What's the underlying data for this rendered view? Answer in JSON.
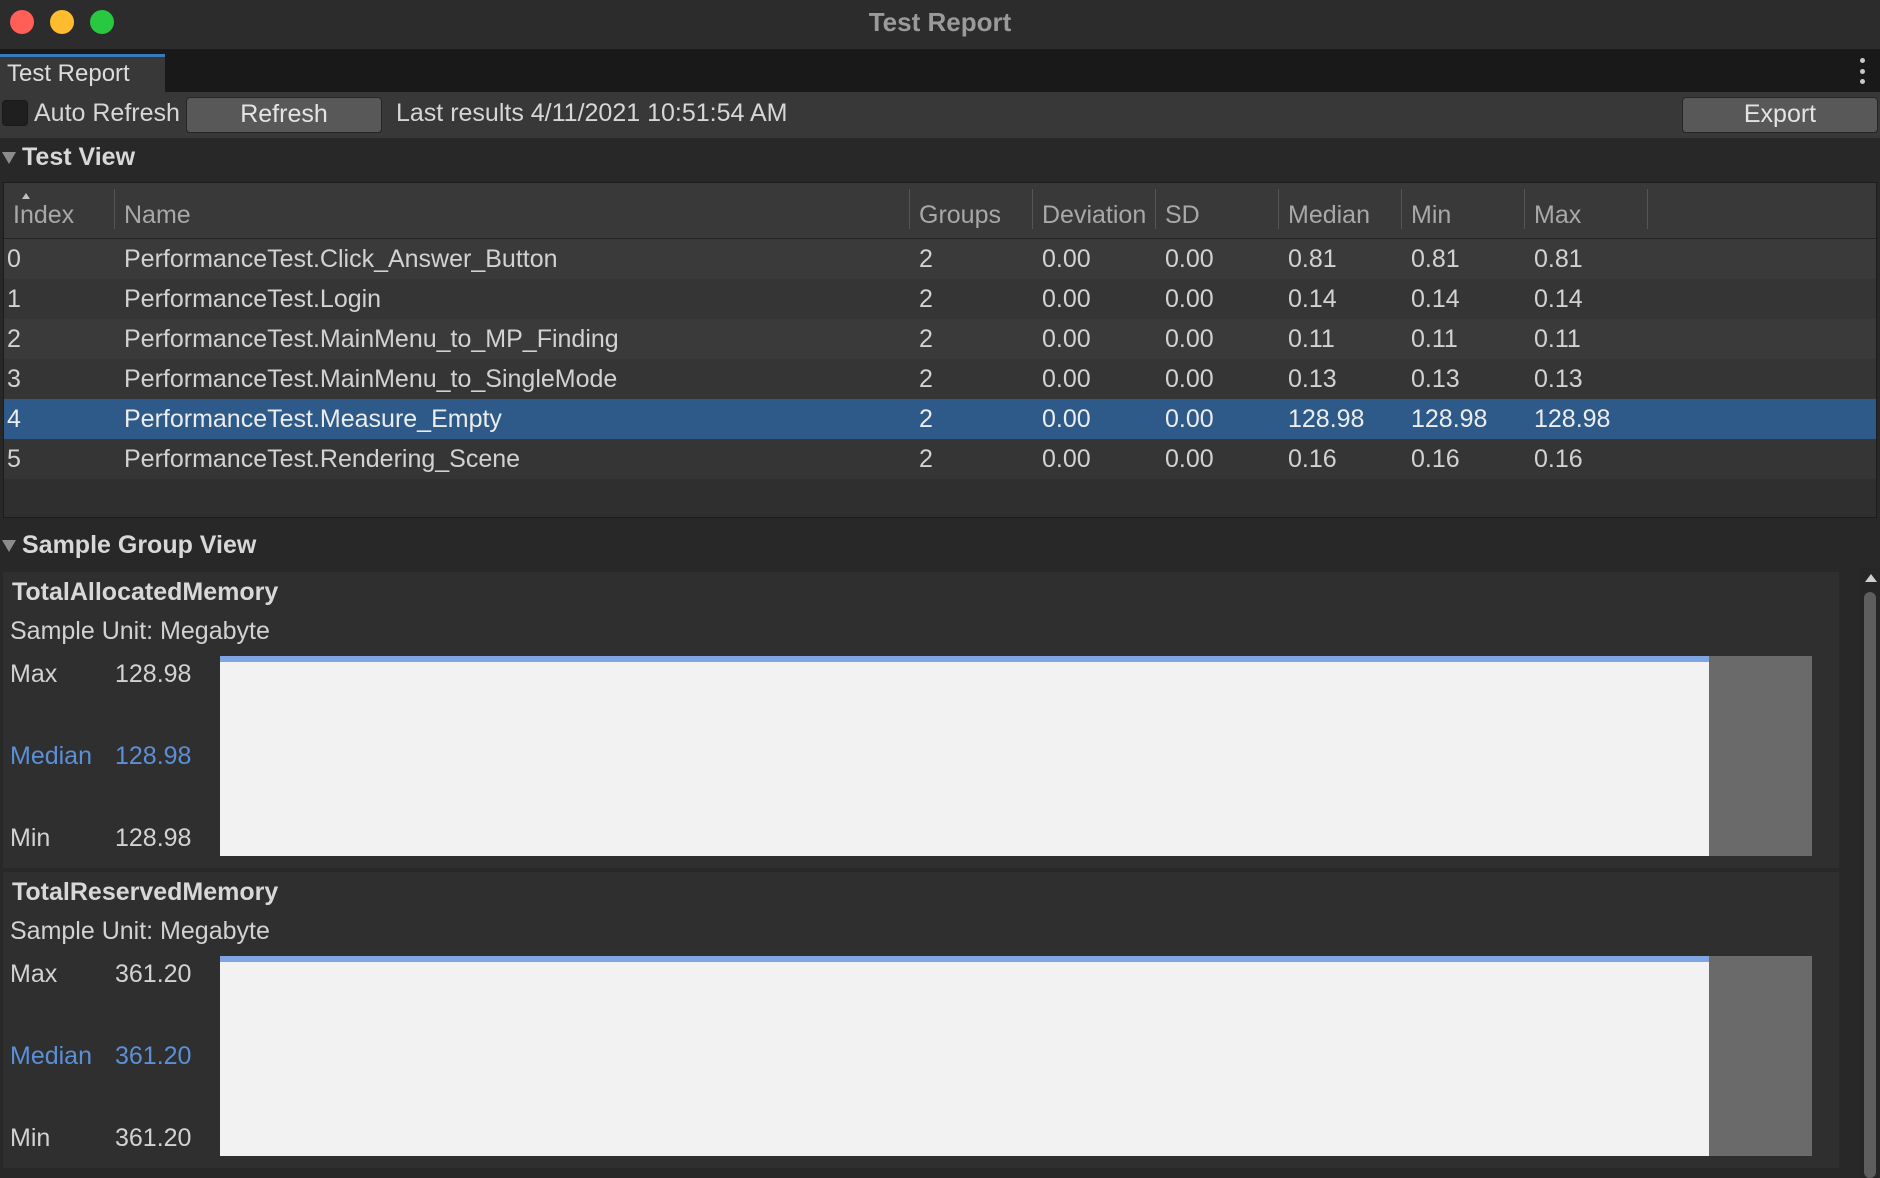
{
  "window": {
    "title": "Test Report"
  },
  "tab": {
    "label": "Test Report"
  },
  "toolbar": {
    "auto_refresh_label": "Auto Refresh",
    "auto_refresh_checked": false,
    "refresh_label": "Refresh",
    "last_results": "Last results 4/11/2021 10:51:54 AM",
    "export_label": "Export"
  },
  "test_view": {
    "title": "Test View",
    "columns": [
      "Index",
      "Name",
      "Groups",
      "Deviation",
      "SD",
      "Median",
      "Min",
      "Max"
    ],
    "rows": [
      [
        "0",
        "PerformanceTest.Click_Answer_Button",
        "2",
        "0.00",
        "0.00",
        "0.81",
        "0.81",
        "0.81"
      ],
      [
        "1",
        "PerformanceTest.Login",
        "2",
        "0.00",
        "0.00",
        "0.14",
        "0.14",
        "0.14"
      ],
      [
        "2",
        "PerformanceTest.MainMenu_to_MP_Finding",
        "2",
        "0.00",
        "0.00",
        "0.11",
        "0.11",
        "0.11"
      ],
      [
        "3",
        "PerformanceTest.MainMenu_to_SingleMode",
        "2",
        "0.00",
        "0.00",
        "0.13",
        "0.13",
        "0.13"
      ],
      [
        "4",
        "PerformanceTest.Measure_Empty",
        "2",
        "0.00",
        "0.00",
        "128.98",
        "128.98",
        "128.98"
      ],
      [
        "5",
        "PerformanceTest.Rendering_Scene",
        "2",
        "0.00",
        "0.00",
        "0.16",
        "0.16",
        "0.16"
      ]
    ],
    "selected_index": 4
  },
  "sample_group_view": {
    "title": "Sample Group View",
    "groups": [
      {
        "name": "TotalAllocatedMemory",
        "unit": "Sample Unit: Megabyte",
        "max_label": "Max",
        "max": "128.98",
        "median_label": "Median",
        "median": "128.98",
        "min_label": "Min",
        "min": "128.98",
        "fill_fraction": 0.935
      },
      {
        "name": "TotalReservedMemory",
        "unit": "Sample Unit: Megabyte",
        "max_label": "Max",
        "max": "361.20",
        "median_label": "Median",
        "median": "361.20",
        "min_label": "Min",
        "min": "361.20",
        "fill_fraction": 0.935
      }
    ]
  },
  "colors": {
    "selection": "#2d5a89",
    "median_text": "#5b8fd8",
    "plot_top_line": "#7fa6e3",
    "tab_accent": "#3a79bb"
  }
}
